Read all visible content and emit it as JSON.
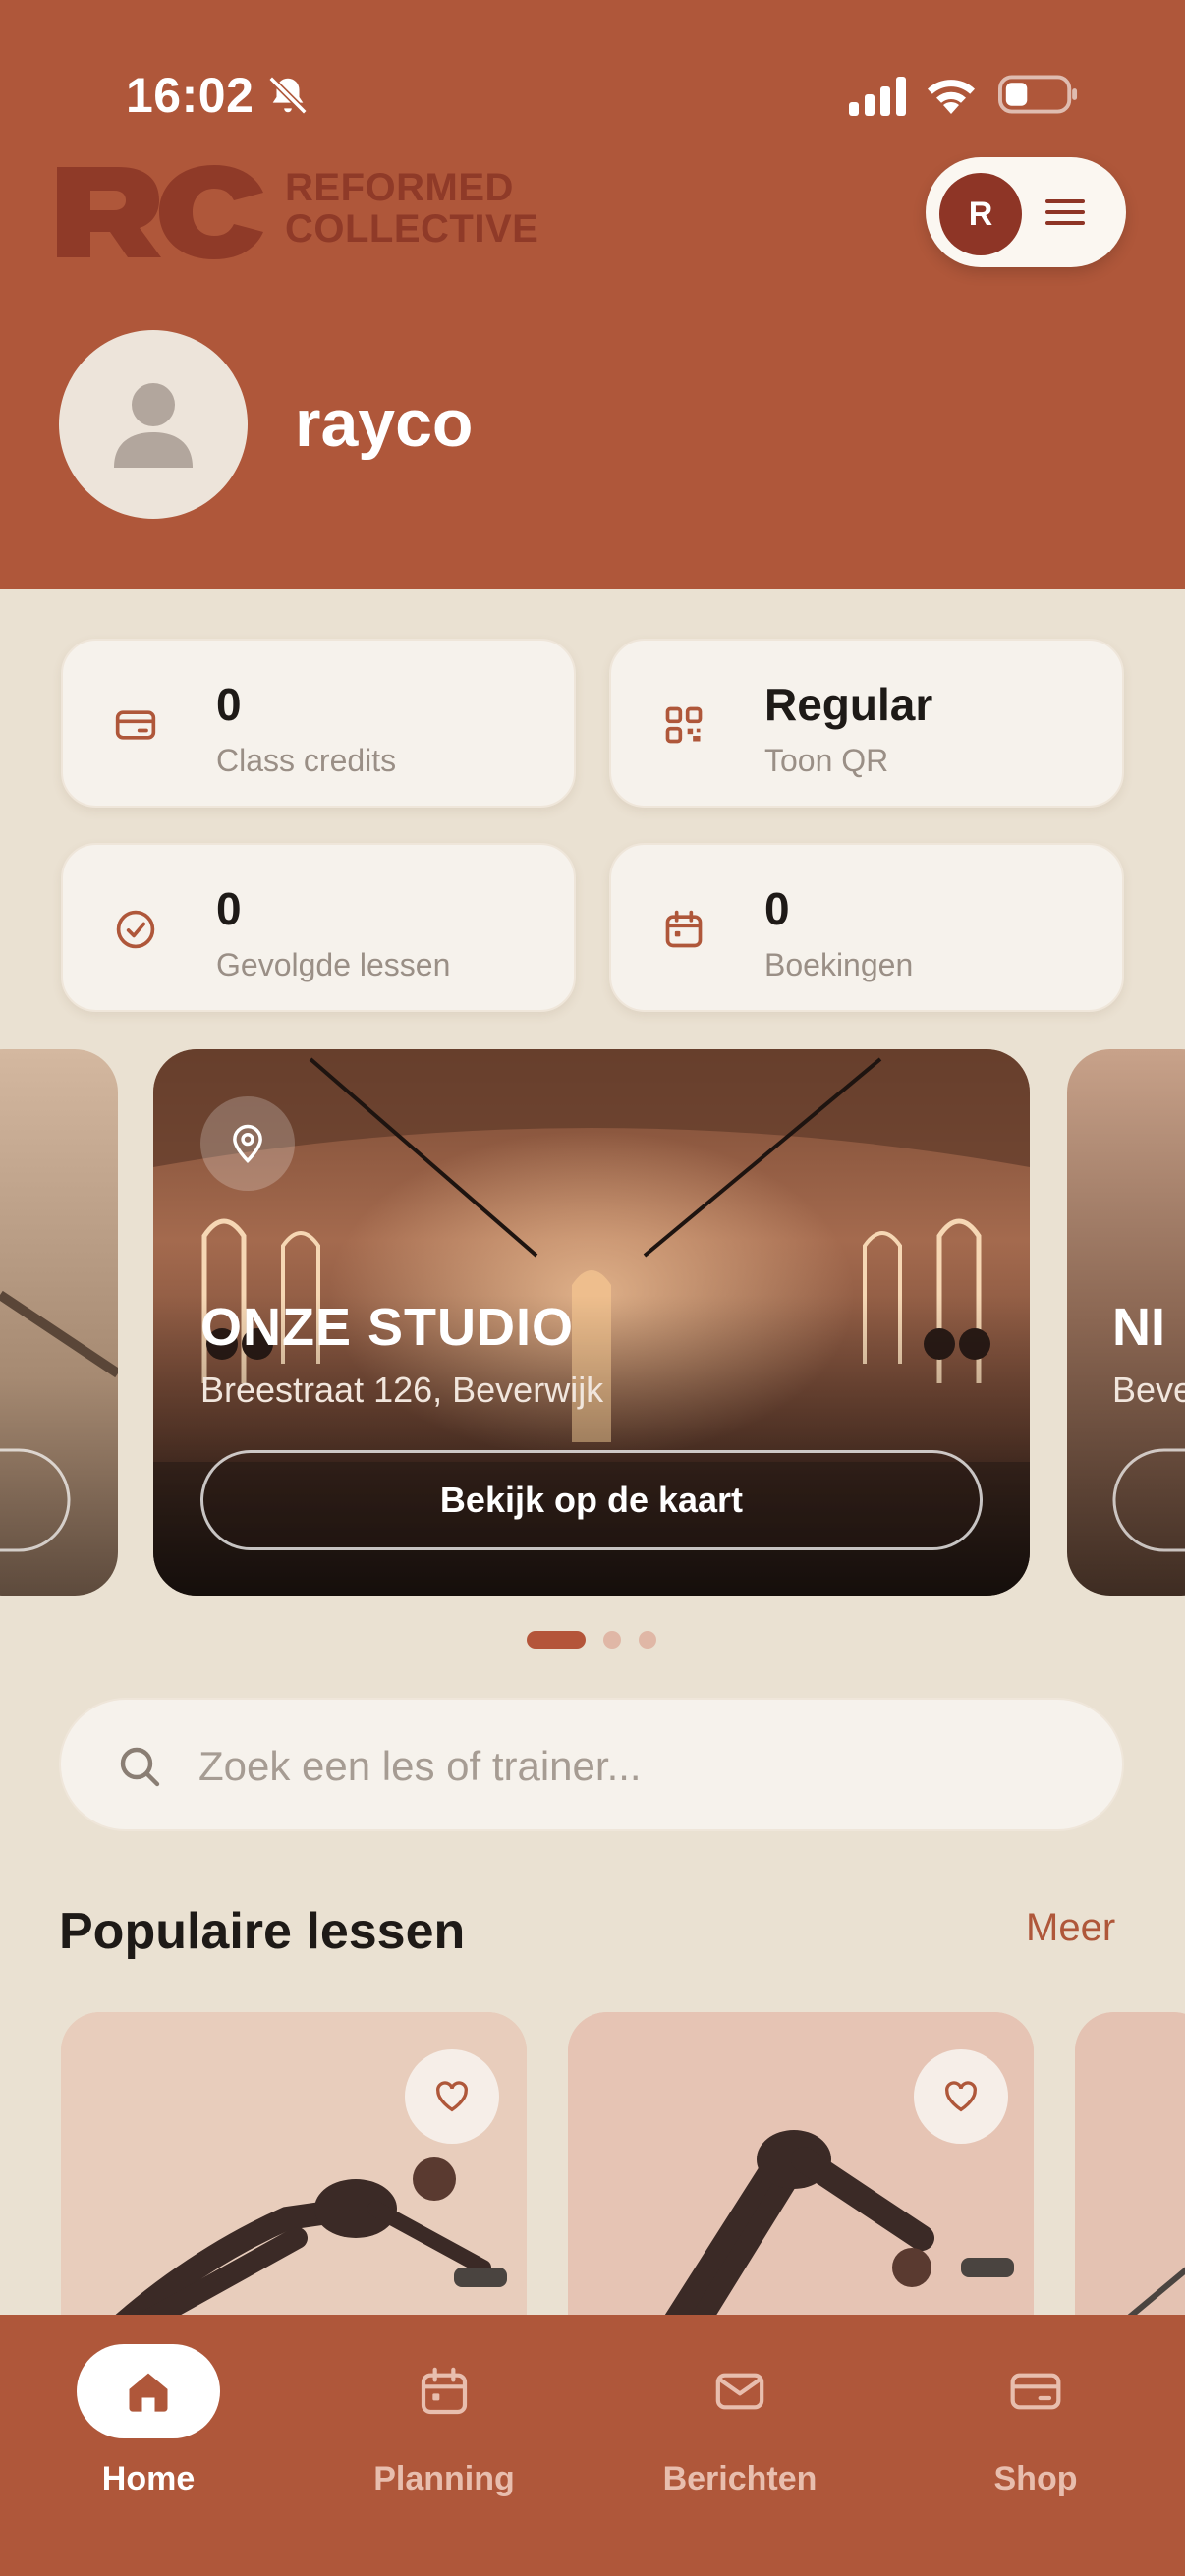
{
  "status_bar": {
    "time": "16:02"
  },
  "brand": {
    "name_line1": "REFORMED",
    "name_line2": "COLLECTIVE",
    "accent": "#AF573A",
    "dark_accent": "#8E3526"
  },
  "header": {
    "pill_initial": "R",
    "username": "rayco"
  },
  "stats": [
    {
      "icon": "credit-card-icon",
      "value": "0",
      "label": "Class credits"
    },
    {
      "icon": "qr-code-icon",
      "value": "Regular",
      "label": "Toon QR"
    },
    {
      "icon": "check-circle-icon",
      "value": "0",
      "label": "Gevolgde lessen"
    },
    {
      "icon": "calendar-icon",
      "value": "0",
      "label": "Boekingen"
    }
  ],
  "carousel": {
    "title": "ONZE STUDIO",
    "address": "Breestraat 126, Beverwijk",
    "button": "Bekijk op de kaart",
    "next_title_partial": "NI",
    "next_address_partial": "Beve",
    "page_count": 3,
    "active_index": 0
  },
  "search": {
    "placeholder": "Zoek een les of trainer...",
    "value": ""
  },
  "popular": {
    "title": "Populaire lessen",
    "more": "Meer"
  },
  "nav": [
    {
      "icon": "home-icon",
      "label": "Home",
      "active": true
    },
    {
      "icon": "calendar-icon",
      "label": "Planning",
      "active": false
    },
    {
      "icon": "mail-icon",
      "label": "Berichten",
      "active": false
    },
    {
      "icon": "wallet-icon",
      "label": "Shop",
      "active": false
    }
  ]
}
